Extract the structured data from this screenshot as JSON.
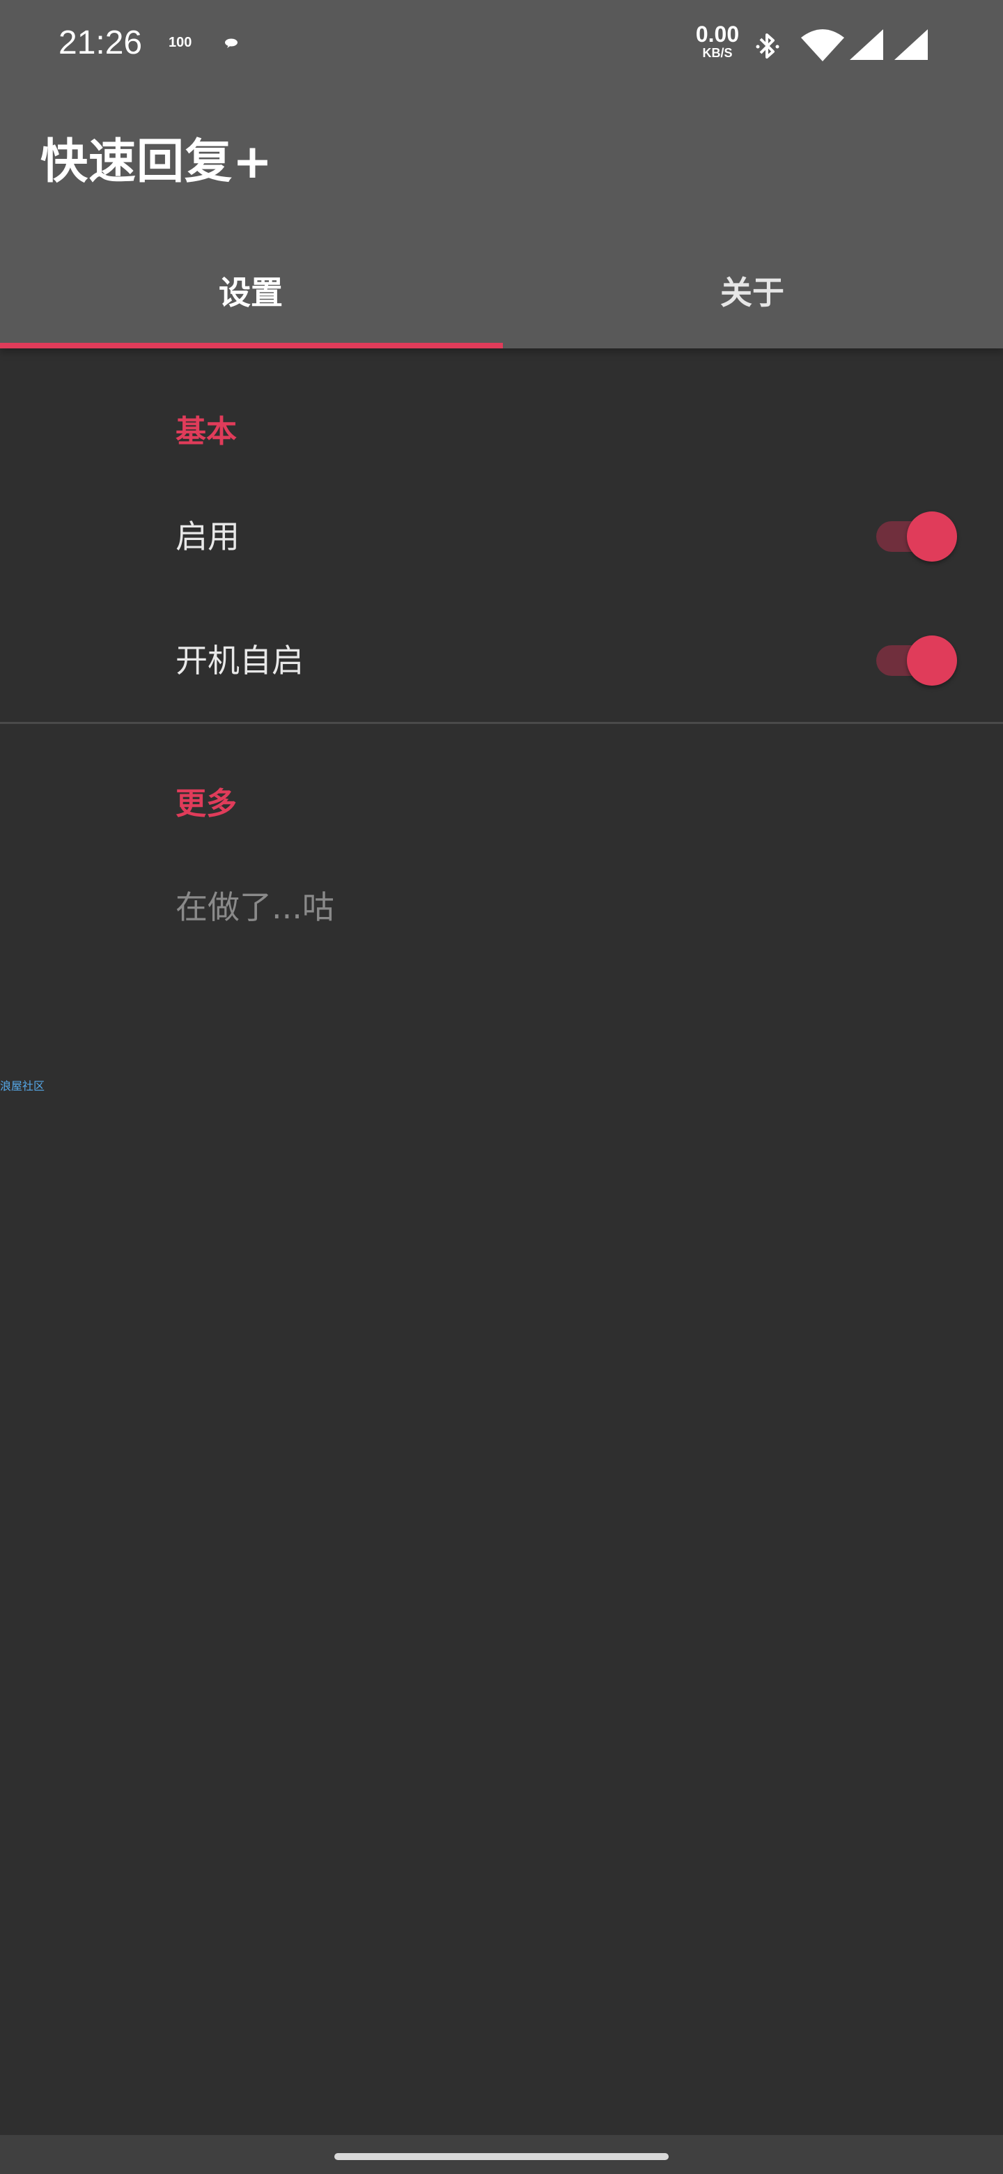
{
  "status_bar": {
    "time": "21:26",
    "battery_level": "100",
    "net_speed_value": "0.00",
    "net_speed_unit": "KB/S",
    "icons": [
      "chat-bubble-icon",
      "bluetooth-icon",
      "wifi-icon",
      "signal-icon",
      "signal-icon"
    ]
  },
  "app_bar": {
    "title": "快速回复+"
  },
  "tabs": [
    {
      "label": "设置",
      "selected": true
    },
    {
      "label": "关于",
      "selected": false
    }
  ],
  "sections": {
    "basic": {
      "header": "基本",
      "items": [
        {
          "label": "启用",
          "checked": true
        },
        {
          "label": "开机自启",
          "checked": true
        }
      ]
    },
    "more": {
      "header": "更多",
      "items": [
        {
          "label": "在做了...咕"
        }
      ]
    }
  },
  "community_link": "浪屋社区",
  "colors": {
    "accent": "#e03c5a",
    "app_bar": "#595959",
    "background": "#2f2f2f",
    "link": "#56a8e8"
  }
}
